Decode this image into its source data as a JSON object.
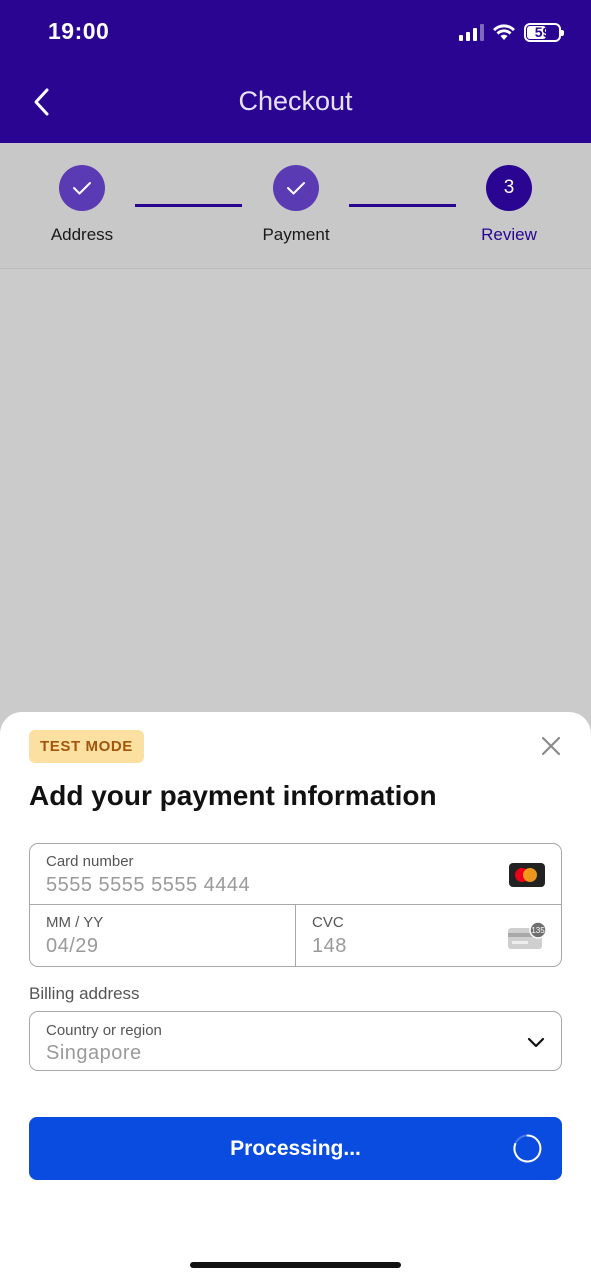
{
  "status_bar": {
    "time": "19:00",
    "battery": "59",
    "icons": [
      "cellular-signal-icon",
      "wifi-icon",
      "battery-icon"
    ]
  },
  "nav": {
    "back_icon": "chevron-left-icon",
    "title": "Checkout"
  },
  "stepper": {
    "steps": [
      {
        "label": "Address",
        "state": "done",
        "icon": "checkmark-icon"
      },
      {
        "label": "Payment",
        "state": "done",
        "icon": "checkmark-icon"
      },
      {
        "label": "Review",
        "state": "current",
        "number": "3"
      }
    ]
  },
  "sheet": {
    "badge": "TEST MODE",
    "close_icon": "close-icon",
    "title": "Add your payment information",
    "card_number": {
      "label": "Card number",
      "value": "5555 5555 5555 4444",
      "brand_icon": "mastercard-icon"
    },
    "expiry": {
      "label": "MM / YY",
      "value": "04/29"
    },
    "cvc": {
      "label": "CVC",
      "value": "148",
      "icon": "cvc-card-icon",
      "icon_text": "135"
    },
    "billing_label": "Billing address",
    "country": {
      "label": "Country or region",
      "value": "Singapore",
      "icon": "chevron-down-icon"
    },
    "submit": {
      "label": "Processing...",
      "icon": "spinner-icon"
    }
  },
  "colors": {
    "header": "#2a0592",
    "step_done": "#5a3bb3",
    "step_current": "#2a0592",
    "badge_bg": "#fbe0a1",
    "badge_text": "#a3560b",
    "button": "#0b4ce0"
  }
}
